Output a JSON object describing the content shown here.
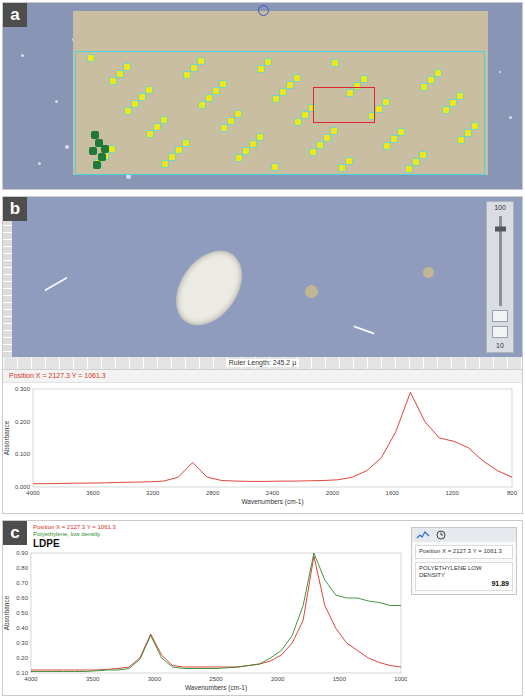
{
  "panel_a": {
    "label": "a"
  },
  "panel_b": {
    "label": "b",
    "ruler": "Ruler Length: 245.2 µ",
    "zoom": {
      "max": "100",
      "min": "10",
      "level": 0.85
    },
    "spectrum": {
      "header": "Position X = 2127.3 Y = 1061.3",
      "y_label": "Absorbance",
      "x_label": "Wavenumbers (cm-1)",
      "x_ticks": [
        "4000",
        "3600",
        "3200",
        "2800",
        "2400",
        "2000",
        "1600",
        "1200",
        "800"
      ],
      "y_ticks": [
        "0.300",
        "0.200",
        "0.100",
        "0.000"
      ],
      "values": [
        0.01,
        0.01,
        0.011,
        0.012,
        0.012,
        0.013,
        0.014,
        0.015,
        0.016,
        0.018,
        0.03,
        0.075,
        0.03,
        0.02,
        0.018,
        0.017,
        0.017,
        0.018,
        0.018,
        0.019,
        0.02,
        0.022,
        0.03,
        0.05,
        0.09,
        0.17,
        0.29,
        0.2,
        0.15,
        0.14,
        0.12,
        0.08,
        0.05,
        0.03
      ]
    }
  },
  "panel_c": {
    "label": "c",
    "title": "LDPE",
    "y_label": "Absorbance",
    "x_label": "Wavenumbers (cm-1)",
    "x_ticks": [
      "4000",
      "3500",
      "3000",
      "2500",
      "2000",
      "1500",
      "1000"
    ],
    "y_ticks": [
      "0.90",
      "0.80",
      "0.70",
      "0.60",
      "0.50",
      "0.40",
      "0.30",
      "0.20",
      "0.10"
    ],
    "series": [
      {
        "legend": "Position X = 2127.3 Y = 1061.3",
        "color": "#d93025",
        "values": [
          0.12,
          0.12,
          0.12,
          0.12,
          0.12,
          0.12,
          0.12,
          0.125,
          0.13,
          0.14,
          0.2,
          0.36,
          0.22,
          0.15,
          0.14,
          0.14,
          0.14,
          0.14,
          0.14,
          0.14,
          0.15,
          0.16,
          0.18,
          0.22,
          0.3,
          0.45,
          0.88,
          0.55,
          0.4,
          0.3,
          0.25,
          0.2,
          0.17,
          0.15,
          0.14
        ]
      },
      {
        "legend": "Polyethylene, low density",
        "color": "#2e8b2e",
        "values": [
          0.11,
          0.11,
          0.11,
          0.11,
          0.11,
          0.11,
          0.115,
          0.12,
          0.12,
          0.13,
          0.19,
          0.35,
          0.2,
          0.14,
          0.13,
          0.13,
          0.13,
          0.13,
          0.135,
          0.14,
          0.15,
          0.16,
          0.2,
          0.25,
          0.35,
          0.55,
          0.9,
          0.72,
          0.62,
          0.6,
          0.6,
          0.58,
          0.57,
          0.55,
          0.55
        ]
      }
    ],
    "side_panel": {
      "entries": [
        {
          "text": "Position X = 2127.3 Y = 1061.3"
        },
        {
          "text": "POLYETHYLENE LOW DENSITY",
          "score": "91.89"
        }
      ]
    }
  }
}
